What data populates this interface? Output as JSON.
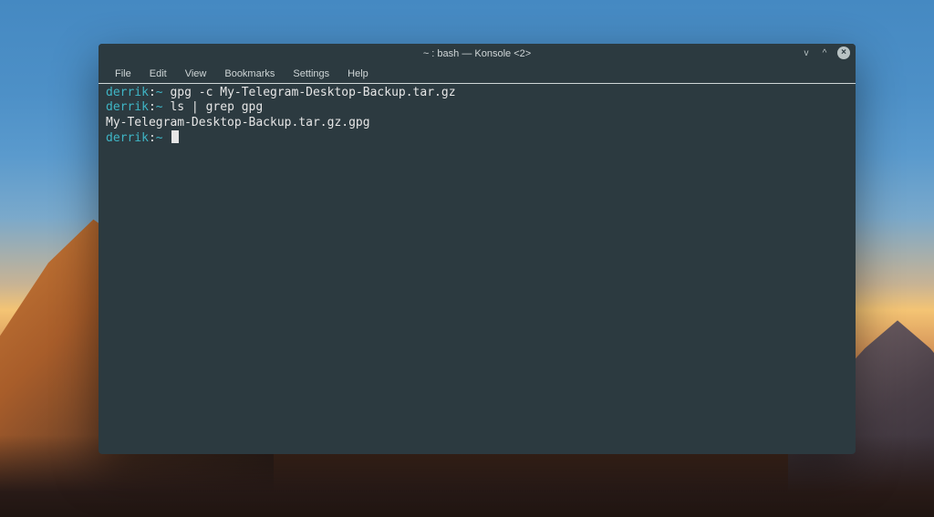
{
  "window": {
    "title": "~ : bash — Konsole <2>"
  },
  "menubar": {
    "items": [
      "File",
      "Edit",
      "View",
      "Bookmarks",
      "Settings",
      "Help"
    ]
  },
  "prompt": {
    "user": "derrik",
    "sep": ":",
    "cwd": "~"
  },
  "lines": {
    "cmd1": "gpg -c My-Telegram-Desktop-Backup.tar.gz",
    "cmd2": "ls | grep gpg",
    "out1": "My-Telegram-Desktop-Backup.tar.gz.gpg"
  },
  "controls": {
    "minimize": "v",
    "maximize": "^",
    "close": "×"
  }
}
